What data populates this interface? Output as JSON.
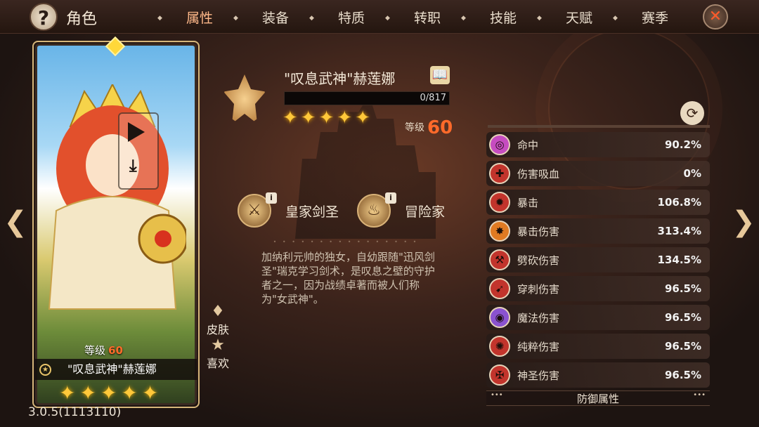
{
  "header": {
    "help_label": "?",
    "title": "角色",
    "tabs": [
      {
        "label": "属性",
        "active": true
      },
      {
        "label": "装备"
      },
      {
        "label": "特质"
      },
      {
        "label": "转职"
      },
      {
        "label": "技能"
      },
      {
        "label": "天赋"
      },
      {
        "label": "赛季"
      }
    ]
  },
  "card": {
    "level_label": "等级",
    "level": "60",
    "name": "\"叹息武神\"赫莲娜",
    "stars": 5
  },
  "side_buttons": {
    "skin": "皮肤",
    "like": "喜欢"
  },
  "hero": {
    "name": "\"叹息武神\"赫莲娜",
    "xp_text": "0/817",
    "stars": 5,
    "level_label": "等级",
    "level": "60",
    "classes": [
      "皇家剑圣",
      "冒险家"
    ],
    "description": "加纳利元帅的独女，自幼跟随\"迅风剑圣\"瑞克学习剑术，是叹息之壁的守护者之一，因为战绩卓著而被人们称为\"女武神\"。"
  },
  "stats": [
    {
      "name": "命中",
      "value": "90.2%",
      "icon": "target-icon",
      "color": "#c64cc0"
    },
    {
      "name": "伤害吸血",
      "value": "0%",
      "icon": "blood-axe-icon",
      "color": "#c2342c"
    },
    {
      "name": "暴击",
      "value": "106.8%",
      "icon": "crit-burst-icon",
      "color": "#c2342c"
    },
    {
      "name": "暴击伤害",
      "value": "313.4%",
      "icon": "crit-damage-icon",
      "color": "#e07a22"
    },
    {
      "name": "劈砍伤害",
      "value": "134.5%",
      "icon": "slash-axe-icon",
      "color": "#c2342c"
    },
    {
      "name": "穿刺伤害",
      "value": "96.5%",
      "icon": "pierce-icon",
      "color": "#c2342c"
    },
    {
      "name": "魔法伤害",
      "value": "96.5%",
      "icon": "magic-swirl-icon",
      "color": "#8a52d0"
    },
    {
      "name": "纯粹伤害",
      "value": "96.5%",
      "icon": "pure-burst-icon",
      "color": "#c2342c"
    },
    {
      "name": "神圣伤害",
      "value": "96.5%",
      "icon": "holy-cross-icon",
      "color": "#c2342c"
    }
  ],
  "section_label": "防御属性",
  "version": "3.0.5(1113110)"
}
